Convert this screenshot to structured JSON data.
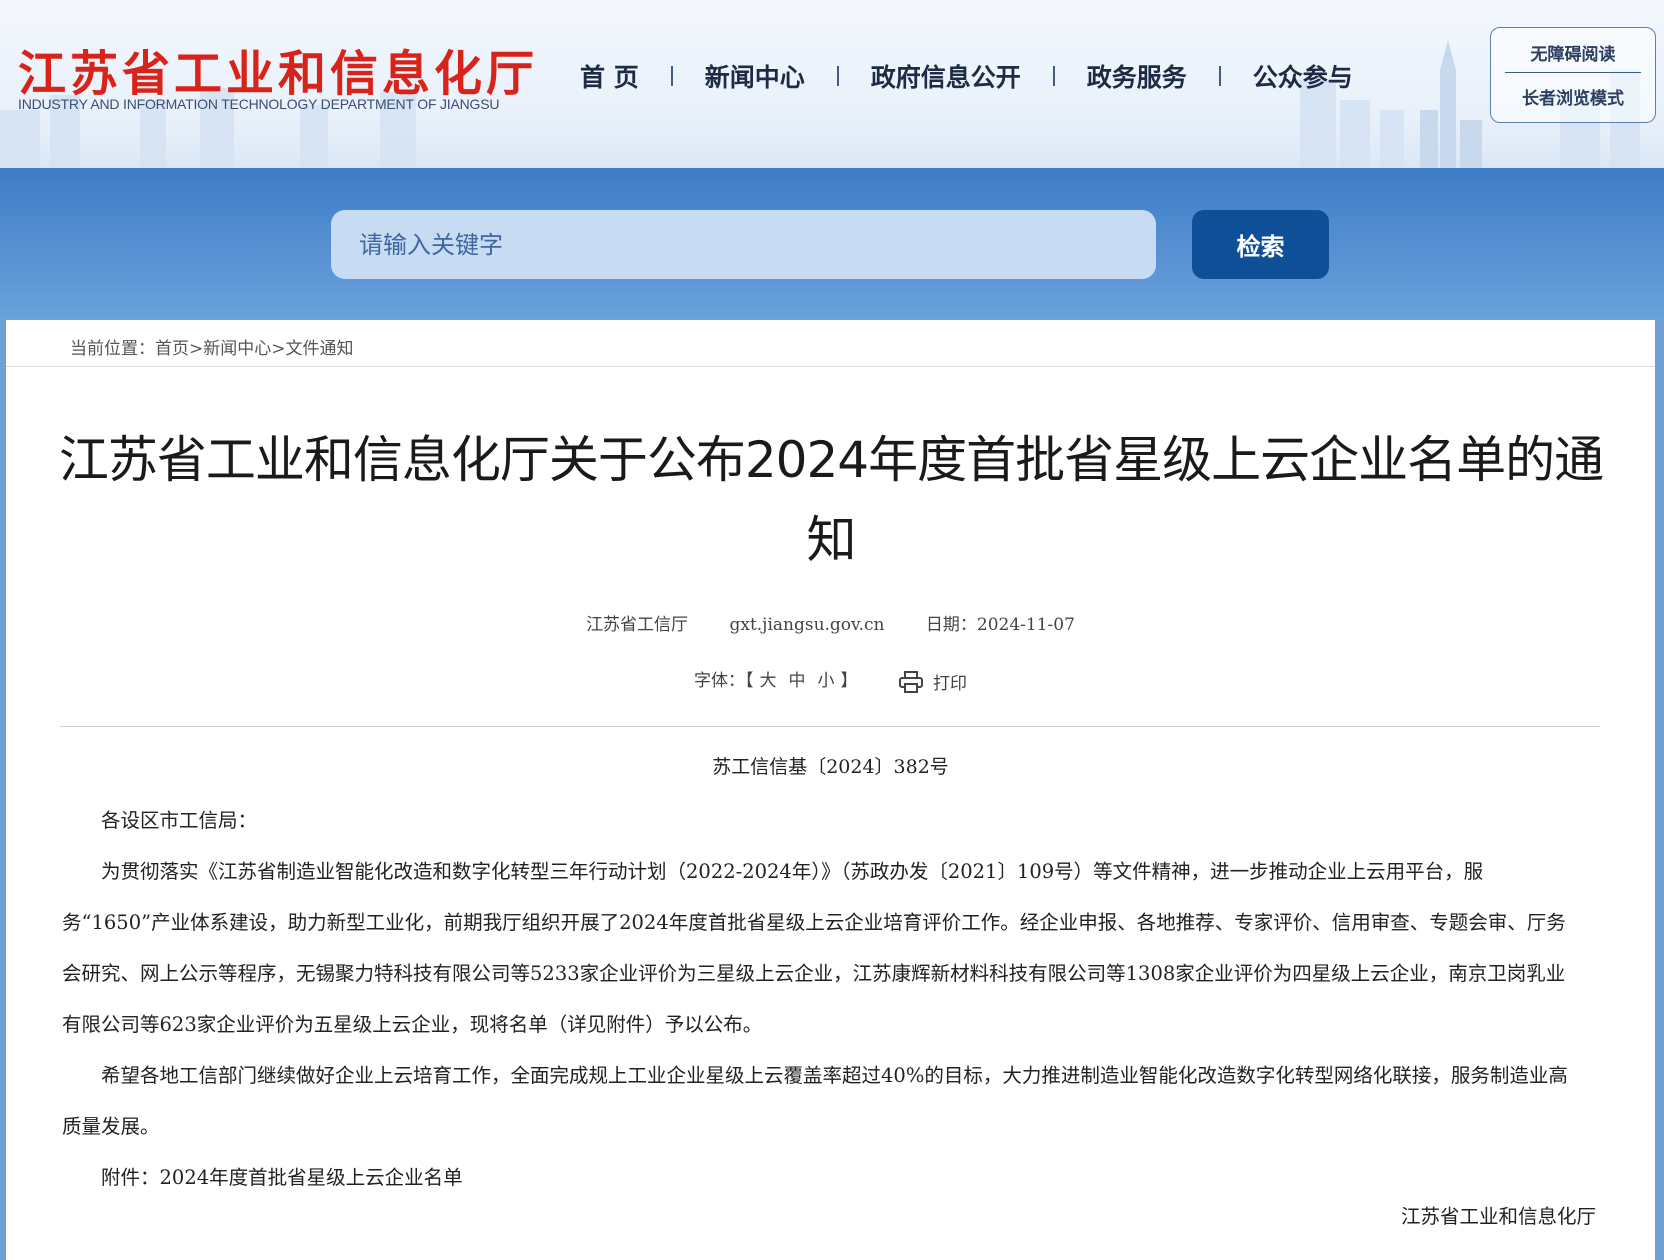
{
  "header": {
    "logo_cn": "江苏省工业和信息化厅",
    "logo_en": "INDUSTRY AND INFORMATION TECHNOLOGY DEPARTMENT OF JIANGSU",
    "nav": [
      "首 页",
      "新闻中心",
      "政府信息公开",
      "政务服务",
      "公众参与"
    ],
    "accessibility": "无障碍阅读",
    "elder_mode": "长者浏览模式"
  },
  "search": {
    "placeholder": "请输入关键字",
    "button": "检索"
  },
  "breadcrumb": {
    "prefix": "当前位置：",
    "items": [
      "首页",
      "新闻中心",
      "文件通知"
    ]
  },
  "article": {
    "title": "江苏省工业和信息化厅关于公布2024年度首批省星级上云企业名单的通知",
    "source": "江苏省工信厅",
    "site": "gxt.jiangsu.gov.cn",
    "date": "日期：2024-11-07",
    "font_label": "字体：",
    "font_sizes": [
      "大",
      "中",
      "小"
    ],
    "print_label": "打印",
    "doc_number": "苏工信信基〔2024〕382号",
    "salutation": "各设区市工信局：",
    "paragraph1": "为贯彻落实《江苏省制造业智能化改造和数字化转型三年行动计划（2022-2024年）》（苏政办发〔2021〕109号）等文件精神，进一步推动企业上云用平台，服务“1650”产业体系建设，助力新型工业化，前期我厅组织开展了2024年度首批省星级上云企业培育评价工作。经企业申报、各地推荐、专家评价、信用审查、专题会审、厅务会研究、网上公示等程序，无锡聚力特科技有限公司等5233家企业评价为三星级上云企业，江苏康辉新材料科技有限公司等1308家企业评价为四星级上云企业，南京卫岗乳业有限公司等623家企业评价为五星级上云企业，现将名单（详见附件）予以公布。",
    "paragraph2": "希望各地工信部门继续做好企业上云培育工作，全面完成规上工业企业星级上云覆盖率超过40%的目标，大力推进制造业智能化改造数字化转型网络化联接，服务制造业高质量发展。",
    "attachment": "附件：2024年度首批省星级上云企业名单",
    "signature": "江苏省工业和信息化厅"
  },
  "colors": {
    "logo_red": "#d8231b",
    "band_blue": "#3d7cc6",
    "button_blue": "#0f4f97",
    "input_bg": "#c7dbf3"
  }
}
